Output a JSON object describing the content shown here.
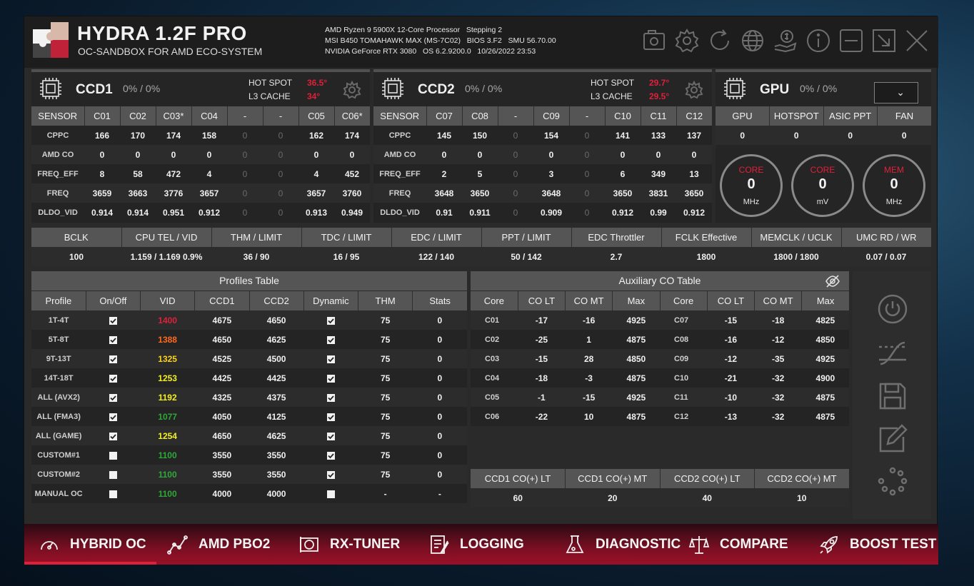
{
  "app": {
    "title": "HYDRA 1.2F PRO",
    "subtitle": "OC-SANDBOX FOR AMD ECO-SYSTEM",
    "sysinfo": [
      "AMD Ryzen 9 5900X 12-Core Processor   Stepping 2",
      "MSI B450 TOMAHAWK MAX (MS-7C02)   BIOS 3.F2   SMU 56.70.00",
      "NVIDIA GeForce RTX 3080   OS 6.2.9200.0   10/26/2022 23:53"
    ],
    "top_icons": [
      "screenshot-icon",
      "settings-icon",
      "refresh-icon",
      "globe-icon",
      "donate-icon",
      "info-icon",
      "minimize-icon",
      "restore-icon",
      "close-icon"
    ]
  },
  "ccd1": {
    "name": "CCD1",
    "pct": "0% / 0%",
    "hotspot_label": "HOT SPOT",
    "hotspot": "36.5°",
    "l3_label": "L3 CACHE",
    "l3": "34°",
    "headers": [
      "SENSOR",
      "C01",
      "C02",
      "C03*",
      "C04",
      "-",
      "-",
      "C05",
      "C06*"
    ],
    "rows": [
      [
        "CPPC",
        "166",
        "170",
        "174",
        "158",
        "0",
        "0",
        "162",
        "174"
      ],
      [
        "AMD CO",
        "0",
        "0",
        "0",
        "0",
        "0",
        "0",
        "0",
        "0"
      ],
      [
        "FREQ_EFF",
        "8",
        "58",
        "472",
        "4",
        "0",
        "0",
        "4",
        "452"
      ],
      [
        "FREQ",
        "3659",
        "3663",
        "3776",
        "3657",
        "0",
        "0",
        "3657",
        "3760"
      ],
      [
        "DLDO_VID",
        "0.914",
        "0.914",
        "0.951",
        "0.912",
        "0",
        "0",
        "0.913",
        "0.949"
      ]
    ]
  },
  "ccd2": {
    "name": "CCD2",
    "pct": "0% / 0%",
    "hotspot_label": "HOT SPOT",
    "hotspot": "29.7°",
    "l3_label": "L3 CACHE",
    "l3": "29.5°",
    "headers": [
      "SENSOR",
      "C07",
      "C08",
      "-",
      "C09",
      "-",
      "C10",
      "C11",
      "C12"
    ],
    "rows": [
      [
        "CPPC",
        "145",
        "150",
        "0",
        "154",
        "0",
        "141",
        "133",
        "137"
      ],
      [
        "AMD CO",
        "0",
        "0",
        "0",
        "0",
        "0",
        "0",
        "0",
        "0"
      ],
      [
        "FREQ_EFF",
        "2",
        "5",
        "0",
        "3",
        "0",
        "6",
        "349",
        "13"
      ],
      [
        "FREQ",
        "3648",
        "3650",
        "0",
        "3648",
        "0",
        "3650",
        "3831",
        "3650"
      ],
      [
        "DLDO_VID",
        "0.91",
        "0.911",
        "0",
        "0.909",
        "0",
        "0.912",
        "0.99",
        "0.912"
      ]
    ]
  },
  "gpu": {
    "name": "GPU",
    "pct": "0% / 0%",
    "headers": [
      "GPU",
      "HOTSPOT",
      "ASIC PPT",
      "FAN"
    ],
    "values": [
      "0",
      "0",
      "0",
      "0"
    ],
    "gauges": [
      {
        "label": "CORE",
        "value": "0",
        "unit": "MHz"
      },
      {
        "label": "CORE",
        "value": "0",
        "unit": "mV"
      },
      {
        "label": "MEM",
        "value": "0",
        "unit": "MHz"
      }
    ]
  },
  "metrics": {
    "headers": [
      "BCLK",
      "CPU TEL / VID",
      "THM / LIMIT",
      "TDC / LIMIT",
      "EDC / LIMIT",
      "PPT / LIMIT",
      "EDC Throttler",
      "FCLK Effective",
      "MEMCLK / UCLK",
      "UMC RD / WR"
    ],
    "values": [
      "100",
      "1.159 / 1.169  0.9%",
      "36 / 90",
      "16 / 95",
      "122 / 140",
      "50 / 142",
      "2.7",
      "1800",
      "1800 / 1800",
      "0.07 / 0.07"
    ]
  },
  "profiles": {
    "title": "Profiles Table",
    "headers": [
      "Profile",
      "On/Off",
      "VID",
      "CCD1",
      "CCD2",
      "Dynamic",
      "THM",
      "Stats"
    ],
    "rows": [
      {
        "name": "1T-4T",
        "on": true,
        "vid": "1400",
        "vid_color": "#e0203a",
        "ccd1": "4675",
        "ccd2": "4650",
        "dyn": true,
        "thm": "75",
        "stats": "0"
      },
      {
        "name": "5T-8T",
        "on": true,
        "vid": "1388",
        "vid_color": "#ff6a1a",
        "ccd1": "4650",
        "ccd2": "4625",
        "dyn": true,
        "thm": "75",
        "stats": "0"
      },
      {
        "name": "9T-13T",
        "on": true,
        "vid": "1325",
        "vid_color": "#ffd21a",
        "ccd1": "4525",
        "ccd2": "4500",
        "dyn": true,
        "thm": "75",
        "stats": "0"
      },
      {
        "name": "14T-18T",
        "on": true,
        "vid": "1253",
        "vid_color": "#f4f020",
        "ccd1": "4425",
        "ccd2": "4425",
        "dyn": true,
        "thm": "75",
        "stats": "0"
      },
      {
        "name": "ALL (AVX2)",
        "on": true,
        "vid": "1192",
        "vid_color": "#f4f020",
        "ccd1": "4325",
        "ccd2": "4375",
        "dyn": true,
        "thm": "75",
        "stats": "0"
      },
      {
        "name": "ALL (FMA3)",
        "on": true,
        "vid": "1077",
        "vid_color": "#2fa83a",
        "ccd1": "4050",
        "ccd2": "4125",
        "dyn": true,
        "thm": "75",
        "stats": "0"
      },
      {
        "name": "ALL (GAME)",
        "on": true,
        "vid": "1254",
        "vid_color": "#f4f020",
        "ccd1": "4650",
        "ccd2": "4625",
        "dyn": true,
        "thm": "75",
        "stats": "0"
      },
      {
        "name": "CUSTOM#1",
        "on": false,
        "vid": "1100",
        "vid_color": "#2fa83a",
        "ccd1": "3550",
        "ccd2": "3550",
        "dyn": true,
        "thm": "75",
        "stats": "0"
      },
      {
        "name": "CUSTOM#2",
        "on": false,
        "vid": "1100",
        "vid_color": "#2fa83a",
        "ccd1": "3550",
        "ccd2": "3550",
        "dyn": true,
        "thm": "75",
        "stats": "0"
      },
      {
        "name": "MANUAL OC",
        "on": false,
        "vid": "1100",
        "vid_color": "#2fa83a",
        "ccd1": "4000",
        "ccd2": "4000",
        "dyn": false,
        "thm": "-",
        "stats": "-"
      }
    ]
  },
  "aux": {
    "title": "Auxiliary CO Table",
    "headers": [
      "Core",
      "CO LT",
      "CO MT",
      "Max",
      "Core",
      "CO LT",
      "CO MT",
      "Max"
    ],
    "rows": [
      [
        "C01",
        "-17",
        "-16",
        "4925",
        "C07",
        "-15",
        "-18",
        "4825"
      ],
      [
        "C02",
        "-25",
        "1",
        "4875",
        "C08",
        "-16",
        "-12",
        "4850"
      ],
      [
        "C03",
        "-15",
        "28",
        "4850",
        "C09",
        "-12",
        "-35",
        "4925"
      ],
      [
        "C04",
        "-18",
        "-3",
        "4875",
        "C10",
        "-21",
        "-32",
        "4900"
      ],
      [
        "C05",
        "-1",
        "-15",
        "4925",
        "C11",
        "-10",
        "-32",
        "4875"
      ],
      [
        "C06",
        "-22",
        "10",
        "4875",
        "C12",
        "-13",
        "-32",
        "4875"
      ]
    ],
    "summary_headers": [
      "CCD1 CO(+) LT",
      "CCD1 CO(+) MT",
      "CCD2 CO(+) LT",
      "CCD2 CO(+) MT"
    ],
    "summary_values": [
      "60",
      "20",
      "40",
      "10"
    ]
  },
  "side_icons": [
    "power-icon",
    "curve-icon",
    "save-icon",
    "edit-icon",
    "loading-icon"
  ],
  "tabs": [
    {
      "label": "HYBRID OC",
      "icon": "speedometer-icon",
      "active": true
    },
    {
      "label": "AMD PBO2",
      "icon": "graph-icon",
      "active": false
    },
    {
      "label": "RX-TUNER",
      "icon": "gpu-card-icon",
      "active": false
    },
    {
      "label": "LOGGING",
      "icon": "log-icon",
      "active": false
    },
    {
      "label": "DIAGNOSTIC",
      "icon": "flask-icon",
      "active": false
    },
    {
      "label": "COMPARE",
      "icon": "scales-icon",
      "active": false
    },
    {
      "label": "BOOST TEST",
      "icon": "rocket-icon",
      "active": false
    }
  ]
}
